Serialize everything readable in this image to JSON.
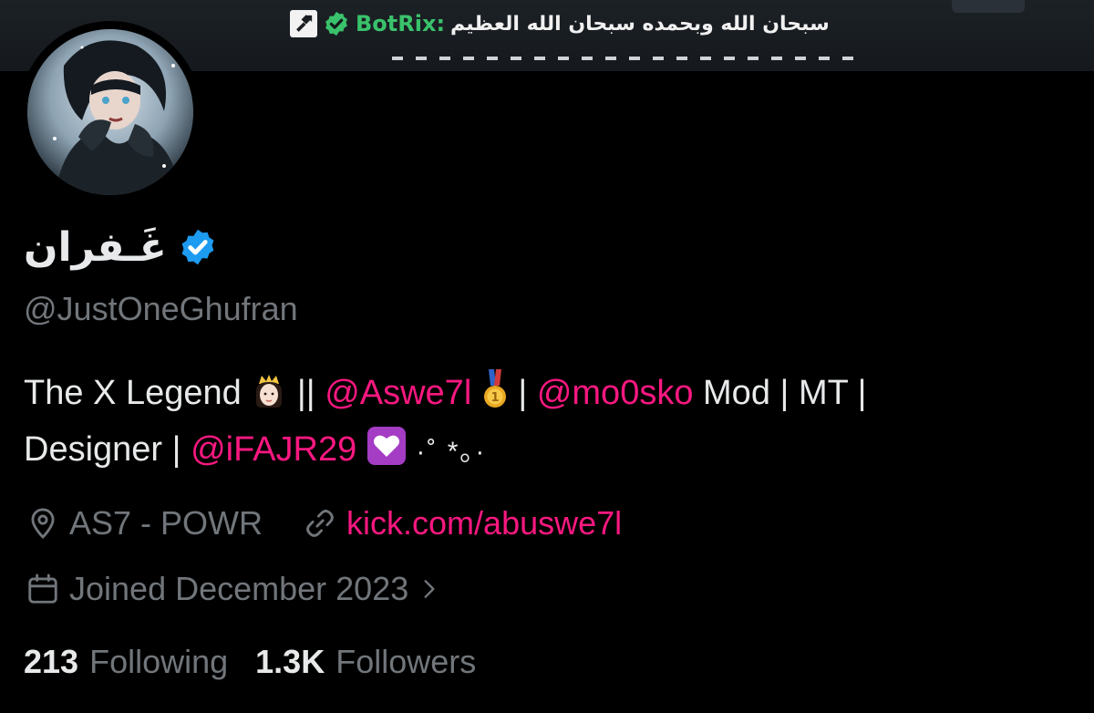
{
  "banner": {
    "bot_name": "BotRix:",
    "message": "سبحان الله وبحمده سبحان الله العظيم"
  },
  "profile": {
    "display_name": "غَـفران",
    "handle": "@JustOneGhufran",
    "verified": true
  },
  "bio": {
    "part1": "The X Legend",
    "sep1": "||",
    "mention1": "@Aswe7l",
    "sep2": "|",
    "mention2": "@mo0sko",
    "part2": "Mod | MT |",
    "part3": "Designer |",
    "mention3": "@iFAJR29",
    "sparkles": "·˚ *｡·"
  },
  "meta": {
    "location": "AS7 - POWR",
    "link": "kick.com/abuswe7l",
    "joined": "Joined December 2023"
  },
  "stats": {
    "following_count": "213",
    "following_label": "Following",
    "followers_count": "1.3K",
    "followers_label": "Followers"
  },
  "colors": {
    "background": "#000000",
    "text_primary": "#e7e9ea",
    "text_secondary": "#71767b",
    "accent_pink": "#f91880",
    "verified_blue": "#1d9bf0",
    "bot_green": "#39c26b"
  },
  "icons": {
    "verified": "verified-badge-icon",
    "location": "location-pin-icon",
    "link": "link-icon",
    "calendar": "calendar-icon",
    "chevron": "chevron-right-icon"
  }
}
